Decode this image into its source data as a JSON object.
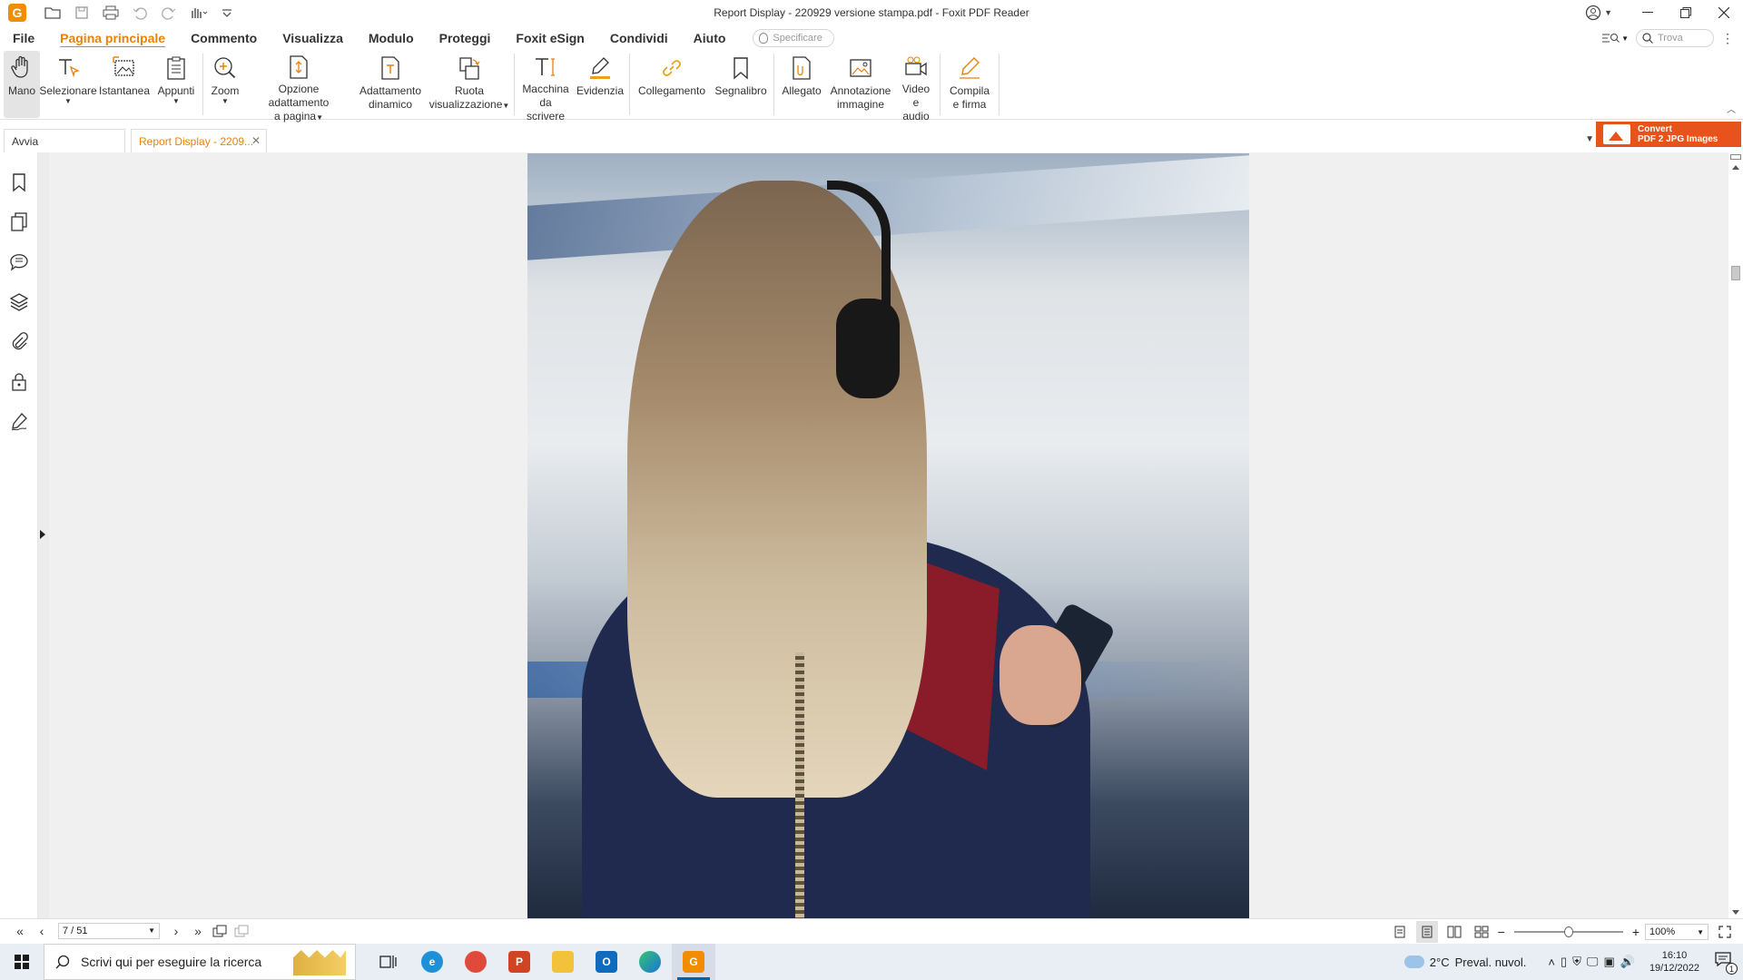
{
  "window": {
    "title": "Report Display - 220929 versione stampa.pdf - Foxit PDF Reader",
    "logo_letter": "G"
  },
  "menu": {
    "items": [
      "File",
      "Pagina principale",
      "Commento",
      "Visualizza",
      "Modulo",
      "Proteggi",
      "Foxit eSign",
      "Condividi",
      "Aiuto"
    ],
    "active_index": 1,
    "tellme_placeholder": "Specificare",
    "find_placeholder": "Trova"
  },
  "ribbon": {
    "hand": "Mano",
    "select": "Selezionare",
    "snapshot": "Istantanea",
    "clipboard": "Appunti",
    "zoom": "Zoom",
    "fit_l1": "Opzione adattamento",
    "fit_l2": "a pagina",
    "reflow_l1": "Adattamento",
    "reflow_l2": "dinamico",
    "rotate_l1": "Ruota",
    "rotate_l2": "visualizzazione",
    "typewriter_l1": "Macchina",
    "typewriter_l2": "da scrivere",
    "highlight": "Evidenzia",
    "link": "Collegamento",
    "bookmark": "Segnalibro",
    "attachment": "Allegato",
    "image_annot_l1": "Annotazione",
    "image_annot_l2": "immagine",
    "video_l1": "Video",
    "video_l2": "e audio",
    "fill_sign_l1": "Compila",
    "fill_sign_l2": "e firma"
  },
  "tabs": {
    "start": "Avvia",
    "doc": "Report Display - 2209..."
  },
  "convert": {
    "line1": "Convert",
    "line2": "PDF 2 JPG Images"
  },
  "status": {
    "page": "7 / 51",
    "zoom": "100%"
  },
  "taskbar": {
    "search_placeholder": "Scrivi qui per eseguire la ricerca",
    "weather_temp": "2°C",
    "weather_desc": "Preval. nuvol.",
    "time": "16:10",
    "date": "19/12/2022",
    "notification_count": "1"
  },
  "colors": {
    "accent": "#e8820c",
    "convert": "#e8531c"
  }
}
